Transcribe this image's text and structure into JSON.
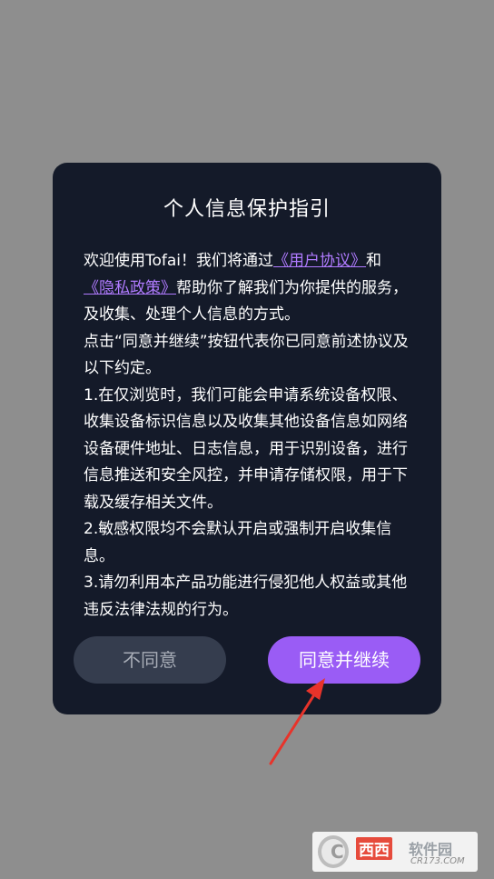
{
  "dialog": {
    "title": "个人信息保护指引",
    "intro_prefix": "欢迎使用Tofai！我们将通过",
    "user_agreement_link": "《用户协议》",
    "and": "和",
    "privacy_policy_link": "《隐私政策》",
    "intro_suffix": "帮助你了解我们为你提供的服务，及收集、处理个人信息的方式。",
    "consent_note": "点击“同意并继续”按钮代表你已同意前述协议及以下约定。",
    "item_1": "1.在仅浏览时，我们可能会申请系统设备权限、收集设备标识信息以及收集其他设备信息如网络设备硬件地址、日志信息，用于识别设备，进行信息推送和安全风控，并申请存储权限，用于下载及缓存相关文件。",
    "item_2": "2.敏感权限均不会默认开启或强制开启收集信息。",
    "item_3": "3.请勿利用本产品功能进行侵犯他人权益或其他违反法律法规的行为。",
    "decline_label": "不同意",
    "accept_label": "同意并继续"
  },
  "watermark": {
    "logo_letter": "C",
    "brand_red": "西西",
    "brand_gray": "软件园",
    "url": "CR173.COM"
  },
  "colors": {
    "overlay": "#8e8e8e",
    "dialog_bg": "#141a29",
    "link": "#b07bff",
    "accept_bg": "#9a5cf5",
    "decline_bg": "#353d4e",
    "annotation_arrow": "#e8332a"
  }
}
